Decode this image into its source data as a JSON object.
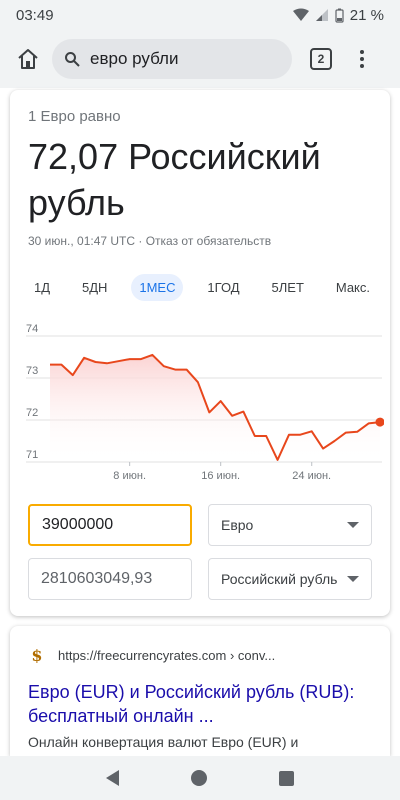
{
  "status_bar": {
    "time": "03:49",
    "battery": "21 %"
  },
  "app_bar": {
    "search_query": "евро рубли",
    "tab_count": "2"
  },
  "converter": {
    "rate_label": "1 Евро равно",
    "rate_value": "72,07 Российский рубль",
    "note": "30 июн., 01:47 UTC · Отказ от обязательств",
    "periods": [
      "1Д",
      "5ДН",
      "1МЕС",
      "1ГОД",
      "5ЛЕТ",
      "Макс."
    ],
    "active_period": "1МЕС",
    "input_amount": "39000000",
    "input_currency": "Евро",
    "output_amount": "2810603049,93",
    "output_currency": "Российский рубль"
  },
  "chart_data": {
    "type": "area",
    "title": "",
    "xlabel": "",
    "ylabel": "",
    "ylim": [
      71,
      74
    ],
    "y_ticks": [
      71,
      72,
      73,
      74
    ],
    "x_tick_labels": [
      "8 июн.",
      "16 июн.",
      "24 июн."
    ],
    "x_tick_days": [
      8,
      16,
      24
    ],
    "x": [
      1,
      2,
      3,
      4,
      5,
      6,
      7,
      8,
      9,
      10,
      11,
      12,
      13,
      14,
      15,
      16,
      17,
      18,
      19,
      20,
      21,
      22,
      23,
      24,
      25,
      26,
      27,
      28,
      29
    ],
    "values": [
      73.32,
      73.32,
      73.07,
      73.48,
      73.38,
      73.35,
      73.4,
      73.45,
      73.45,
      73.55,
      73.28,
      73.2,
      73.2,
      72.9,
      72.18,
      72.45,
      72.1,
      72.2,
      71.62,
      71.62,
      71.05,
      71.65,
      71.65,
      71.73,
      71.32,
      71.5,
      71.7,
      71.72,
      71.92,
      71.95
    ],
    "line_color": "#e8471c",
    "fill_color": "#fbd3d3",
    "grid": true
  },
  "search_result": {
    "site_url": "https://freecurrencyrates.com › conv...",
    "favicon": "$",
    "title": "Евро (EUR) и Российский рубль (RUB): бесплатный онлайн ...",
    "snippet": "Онлайн конвертация валют Евро (EUR) и"
  }
}
